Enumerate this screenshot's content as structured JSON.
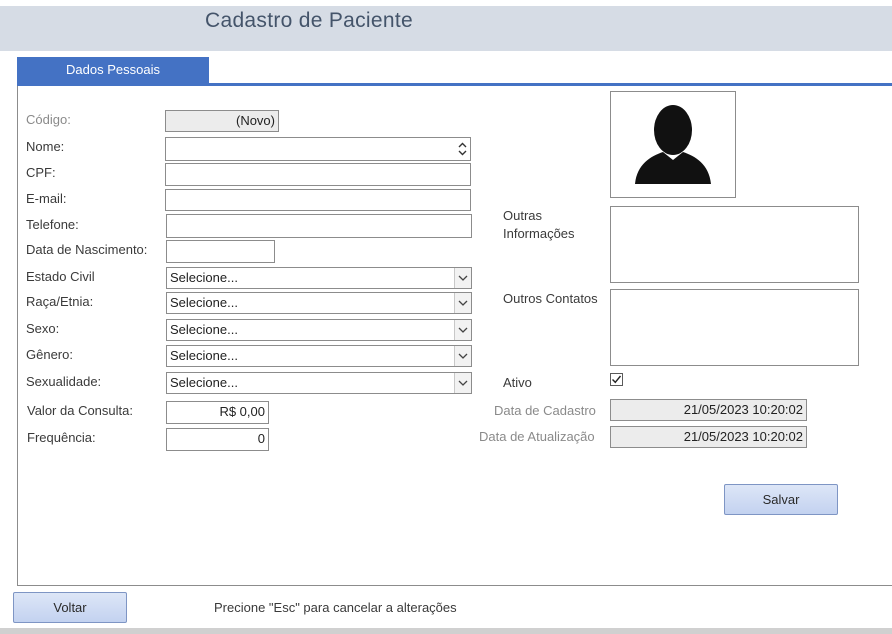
{
  "header": {
    "title": "Cadastro de Paciente"
  },
  "tabs": [
    {
      "label": "Dados Pessoais"
    }
  ],
  "form": {
    "codigo": {
      "label": "Código:",
      "value": "(Novo)"
    },
    "nome": {
      "label": "Nome:",
      "value": ""
    },
    "cpf": {
      "label": "CPF:",
      "value": ""
    },
    "email": {
      "label": "E-mail:",
      "value": ""
    },
    "telefone": {
      "label": "Telefone:",
      "value": ""
    },
    "data_nascimento": {
      "label": "Data de Nascimento:",
      "value": ""
    },
    "estado_civil": {
      "label": "Estado Civil",
      "value": "Selecione..."
    },
    "raca_etnia": {
      "label": "Raça/Etnia:",
      "value": "Selecione..."
    },
    "sexo": {
      "label": "Sexo:",
      "value": "Selecione..."
    },
    "genero": {
      "label": "Gênero:",
      "value": "Selecione..."
    },
    "sexualidade": {
      "label": "Sexualidade:",
      "value": "Selecione..."
    },
    "valor_consulta": {
      "label": "Valor da Consulta:",
      "value": "R$ 0,00"
    },
    "frequencia": {
      "label": "Frequência:",
      "value": "0"
    },
    "outras_informacoes": {
      "label_line1": "Outras",
      "label_line2": "Informações",
      "value": ""
    },
    "outros_contatos": {
      "label": "Outros Contatos",
      "value": ""
    },
    "ativo": {
      "label": "Ativo",
      "checked": true
    },
    "data_cadastro": {
      "label": "Data de Cadastro",
      "value": "21/05/2023 10:20:02"
    },
    "data_atualizacao": {
      "label": "Data de Atualização",
      "value": "21/05/2023 10:20:02"
    }
  },
  "buttons": {
    "salvar": "Salvar",
    "voltar": "Voltar"
  },
  "footer": {
    "hint": "Precione \"Esc\" para cancelar a alterações"
  },
  "icons": {
    "photo": "person-silhouette-icon",
    "dropdown": "chevron-down-icon",
    "check": "checkmark-icon",
    "spinner": "spinner-up-down-icon"
  },
  "colors": {
    "accent": "#4472c4",
    "header_band": "#d6dce5",
    "title": "#44546a",
    "button": "#c9d6f0"
  }
}
